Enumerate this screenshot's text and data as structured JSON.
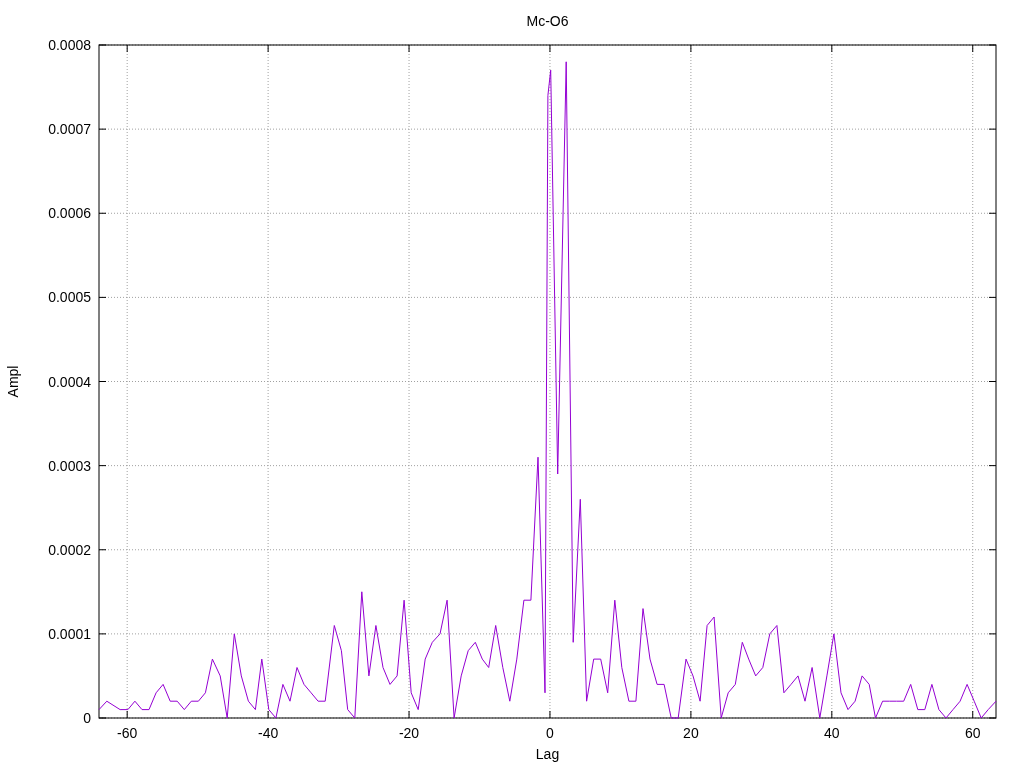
{
  "chart_data": {
    "type": "line",
    "title": "Mc-O6",
    "xlabel": "Lag",
    "ylabel": "Ampl",
    "x": [
      -64,
      -62.9,
      -61,
      -59.9,
      -58.9,
      -57.9,
      -56.9,
      -55.9,
      -54.9,
      -53.9,
      -52.9,
      -51.9,
      -50.9,
      -49.9,
      -48.9,
      -47.9,
      -46.8,
      -45.8,
      -44.8,
      -43.8,
      -42.8,
      -41.8,
      -40.9,
      -39.9,
      -38.9,
      -37.9,
      -36.9,
      -35.9,
      -34.9,
      -33.9,
      -32.9,
      -31.9,
      -30.6,
      -29.6,
      -28.7,
      -27.7,
      -26.7,
      -25.7,
      -24.7,
      -23.7,
      -22.7,
      -21.7,
      -20.7,
      -19.7,
      -18.7,
      -17.7,
      -16.7,
      -15.6,
      -14.6,
      -13.6,
      -12.6,
      -11.6,
      -10.6,
      -9.6,
      -8.7,
      -7.7,
      -6.7,
      -5.7,
      -4.7,
      -3.7,
      -2.7,
      -1.7,
      -0.7,
      -0.3,
      0.1,
      1.1,
      2.3,
      3.3,
      4.3,
      5.2,
      6.2,
      7.2,
      8.2,
      9.2,
      10.2,
      11.2,
      12.2,
      13.2,
      14.2,
      15.2,
      16.2,
      17.2,
      18.2,
      19.3,
      20.3,
      21.3,
      22.3,
      23.3,
      24.3,
      25.3,
      26.3,
      27.3,
      28.2,
      29.2,
      30.2,
      31.2,
      32.2,
      33.2,
      34.2,
      35.2,
      36.2,
      37.2,
      38.3,
      39.3,
      40.3,
      41.3,
      42.3,
      43.3,
      44.3,
      45.3,
      46.2,
      47.2,
      48.2,
      49.2,
      50.2,
      51.2,
      52.2,
      53.2,
      54.2,
      55.2,
      56.2,
      57.2,
      58.2,
      59.2,
      60.2,
      61.2,
      62.2,
      63.3
    ],
    "series": [
      {
        "color": "#9400d3",
        "values": [
          1e-05,
          2e-05,
          1e-05,
          1e-05,
          2e-05,
          1e-05,
          1e-05,
          3e-05,
          4e-05,
          2e-05,
          2e-05,
          1e-05,
          2e-05,
          2e-05,
          3e-05,
          7e-05,
          5e-05,
          0,
          0.0001,
          5e-05,
          2e-05,
          1e-05,
          7e-05,
          1e-05,
          0,
          4e-05,
          2e-05,
          6e-05,
          4e-05,
          3e-05,
          2e-05,
          2e-05,
          0.00011,
          8e-05,
          1e-05,
          0,
          0.00015,
          5e-05,
          0.00011,
          6e-05,
          4e-05,
          5e-05,
          0.00014,
          3e-05,
          1e-05,
          7e-05,
          9e-05,
          0.0001,
          0.00014,
          0,
          5e-05,
          8e-05,
          9e-05,
          7e-05,
          6e-05,
          0.00011,
          6e-05,
          2e-05,
          7e-05,
          0.00014,
          0.00014,
          0.00031,
          3e-05,
          0.00074,
          0.00077,
          0.00029,
          0.00078,
          9e-05,
          0.00026,
          2e-05,
          7e-05,
          7e-05,
          3e-05,
          0.00014,
          6e-05,
          2e-05,
          2e-05,
          0.00013,
          7e-05,
          4e-05,
          4e-05,
          0,
          0,
          7e-05,
          5e-05,
          2e-05,
          0.00011,
          0.00012,
          0,
          3e-05,
          4e-05,
          9e-05,
          7e-05,
          5e-05,
          6e-05,
          0.0001,
          0.00011,
          3e-05,
          4e-05,
          5e-05,
          2e-05,
          6e-05,
          0,
          5e-05,
          0.0001,
          3e-05,
          1e-05,
          2e-05,
          5e-05,
          4e-05,
          0,
          2e-05,
          2e-05,
          2e-05,
          2e-05,
          4e-05,
          1e-05,
          1e-05,
          4e-05,
          1e-05,
          0,
          1e-05,
          2e-05,
          4e-05,
          2e-05,
          0,
          1e-05,
          2e-05
        ]
      }
    ],
    "grid": true,
    "xlim": [
      -64,
      63.3
    ],
    "ylim": [
      0,
      0.0008
    ],
    "xticks": [
      -60,
      -40,
      -20,
      0,
      20,
      40,
      60
    ],
    "yticks": [
      0,
      0.0001,
      0.0002,
      0.0003,
      0.0004,
      0.0005,
      0.0006,
      0.0007,
      0.0008
    ]
  }
}
